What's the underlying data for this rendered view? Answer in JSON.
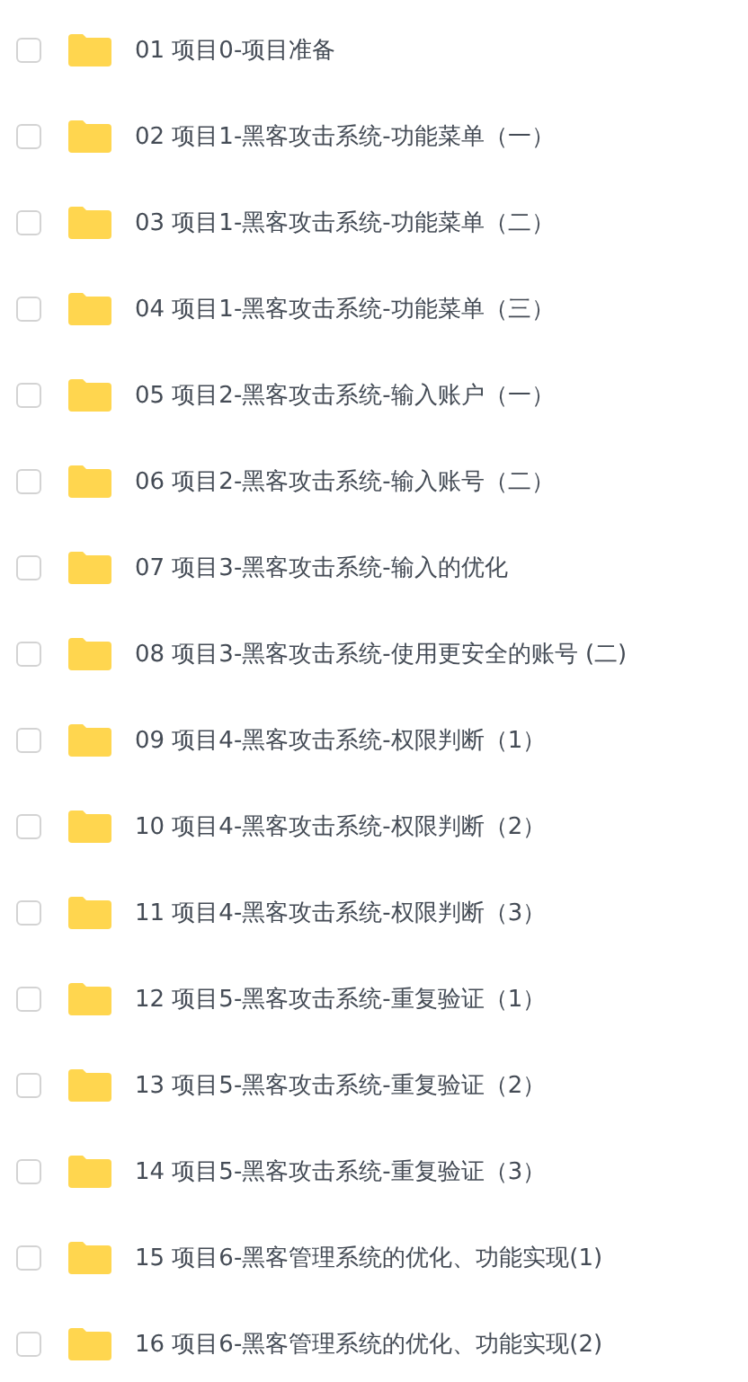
{
  "files": [
    {
      "name": "01 项目0-项目准备",
      "checked": false
    },
    {
      "name": "02 项目1-黑客攻击系统-功能菜单（一）",
      "checked": false
    },
    {
      "name": "03 项目1-黑客攻击系统-功能菜单（二）",
      "checked": false
    },
    {
      "name": "04 项目1-黑客攻击系统-功能菜单（三）",
      "checked": false
    },
    {
      "name": "05 项目2-黑客攻击系统-输入账户（一）",
      "checked": false
    },
    {
      "name": "06 项目2-黑客攻击系统-输入账号（二）",
      "checked": false
    },
    {
      "name": "07 项目3-黑客攻击系统-输入的优化",
      "checked": false
    },
    {
      "name": "08 项目3-黑客攻击系统-使用更安全的账号 (二)",
      "checked": false
    },
    {
      "name": "09 项目4-黑客攻击系统-权限判断（1）",
      "checked": false
    },
    {
      "name": "10 项目4-黑客攻击系统-权限判断（2）",
      "checked": false
    },
    {
      "name": "11 项目4-黑客攻击系统-权限判断（3）",
      "checked": false
    },
    {
      "name": "12 项目5-黑客攻击系统-重复验证（1）",
      "checked": false
    },
    {
      "name": "13 项目5-黑客攻击系统-重复验证（2）",
      "checked": false
    },
    {
      "name": "14 项目5-黑客攻击系统-重复验证（3）",
      "checked": false
    },
    {
      "name": "15 项目6-黑客管理系统的优化、功能实现(1)",
      "checked": false
    },
    {
      "name": "16 项目6-黑客管理系统的优化、功能实现(2)",
      "checked": false
    }
  ]
}
